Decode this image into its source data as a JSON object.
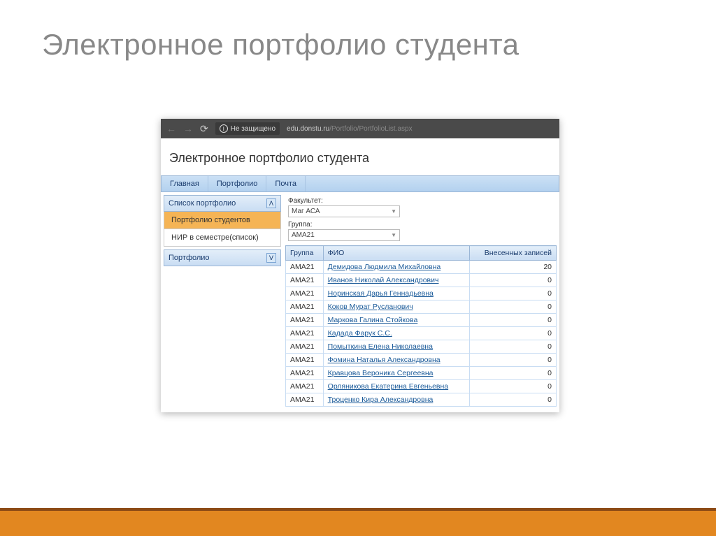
{
  "slide": {
    "title": "Электронное портфолио студента"
  },
  "browser": {
    "security_label": "Не защищено",
    "url_host": "edu.donstu.ru",
    "url_path": "/Portfolio/PortfolioList.aspx"
  },
  "page": {
    "title": "Электронное портфолио студента"
  },
  "menu": {
    "items": [
      "Главная",
      "Портфолио",
      "Почта"
    ]
  },
  "sidebar": {
    "section1": {
      "title": "Список портфолио",
      "items": [
        "Портфолио студентов",
        "НИР в семестре(список)"
      ]
    },
    "section2": {
      "title": "Портфолио"
    }
  },
  "filters": {
    "faculty_label": "Факультет:",
    "faculty_value": "Маг АСА",
    "group_label": "Группа:",
    "group_value": "АМА21"
  },
  "table": {
    "headers": {
      "group": "Группа",
      "fio": "ФИО",
      "count": "Внесенных записей"
    },
    "rows": [
      {
        "group": "АМА21",
        "fio": "Демидова Людмила Михайловна",
        "count": "20"
      },
      {
        "group": "АМА21",
        "fio": "Иванов Николай Александрович",
        "count": "0"
      },
      {
        "group": "АМА21",
        "fio": "Норинская Дарья Геннадьевна",
        "count": "0"
      },
      {
        "group": "АМА21",
        "fio": "Коков Мурат Русланович",
        "count": "0"
      },
      {
        "group": "АМА21",
        "fio": "Маркова Галина Стойкова",
        "count": "0"
      },
      {
        "group": "АМА21",
        "fio": "Кадада Фарук С.С.",
        "count": "0"
      },
      {
        "group": "АМА21",
        "fio": "Помыткина Елена Николаевна",
        "count": "0"
      },
      {
        "group": "АМА21",
        "fio": "Фомина Наталья Александровна",
        "count": "0"
      },
      {
        "group": "АМА21",
        "fio": "Кравцова Вероника Сергеевна",
        "count": "0"
      },
      {
        "group": "АМА21",
        "fio": "Орляникова Екатерина Евгеньевна",
        "count": "0"
      },
      {
        "group": "АМА21",
        "fio": "Троценко Кира Александровна",
        "count": "0"
      }
    ]
  }
}
